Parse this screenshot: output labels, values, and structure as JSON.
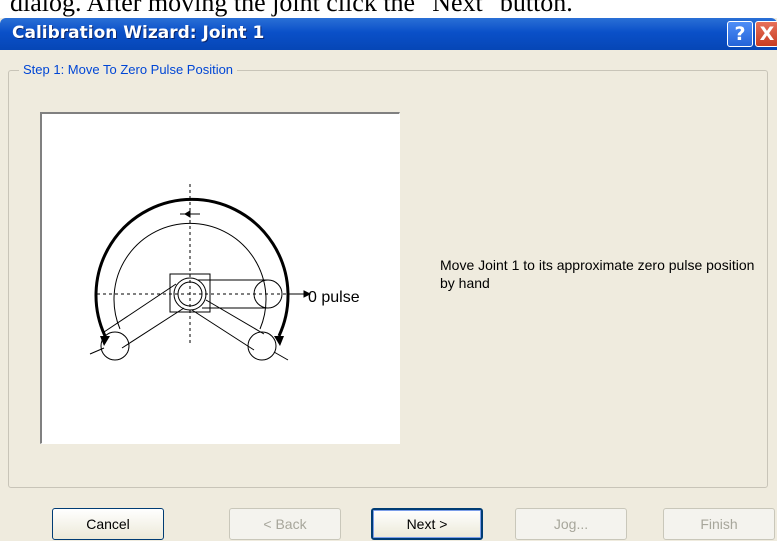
{
  "doc_text": "dialog.  After moving the joint click the \"Next\" button.",
  "window": {
    "title": "Calibration Wizard: Joint 1",
    "help_label": "?",
    "close_label": "X"
  },
  "step": {
    "label": "Step 1: Move To Zero Pulse Position",
    "diagram_label": "0 pulse",
    "instructions": "Move Joint 1 to its approximate zero pulse position by hand"
  },
  "buttons": {
    "cancel": "Cancel",
    "back": "< Back",
    "next": "Next >",
    "jog": "Jog...",
    "finish": "Finish"
  },
  "colors": {
    "titlebar": "#0a50c8",
    "dialog_bg": "#efebde",
    "groupbox_label": "#0046d5"
  }
}
